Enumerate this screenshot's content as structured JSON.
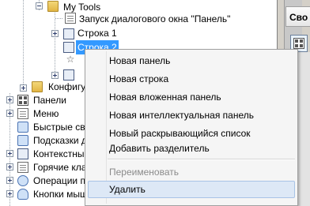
{
  "tree": {
    "items": [
      {
        "label": "My Tools"
      },
      {
        "label": "Запуск диалогового окна \"Панель\""
      },
      {
        "label": "Строка 1"
      },
      {
        "label": "Строка 2"
      },
      {
        "label": "Конфигу"
      },
      {
        "label": "Панели"
      },
      {
        "label": "Меню"
      },
      {
        "label": "Быстрые св"
      },
      {
        "label": "Подсказки д"
      },
      {
        "label": "Контекстны"
      },
      {
        "label": "Горячие кла"
      },
      {
        "label": "Операции пр"
      },
      {
        "label": "Кнопки мыш"
      }
    ]
  },
  "right_pane": {
    "header": "Сво"
  },
  "context_menu": {
    "items": [
      {
        "label": "Новая панель",
        "enabled": true
      },
      {
        "label": "Новая строка",
        "enabled": true
      },
      {
        "label": "Новая вложенная панель",
        "enabled": true
      },
      {
        "label": "Новая интеллектуальная панель",
        "enabled": true
      },
      {
        "label": "Новый раскрывающийся список",
        "enabled": true
      },
      {
        "label": "Добавить разделитель",
        "enabled": true
      },
      {
        "label": "Переименовать",
        "enabled": false
      },
      {
        "label": "Удалить",
        "enabled": true,
        "hovered": true
      }
    ]
  }
}
